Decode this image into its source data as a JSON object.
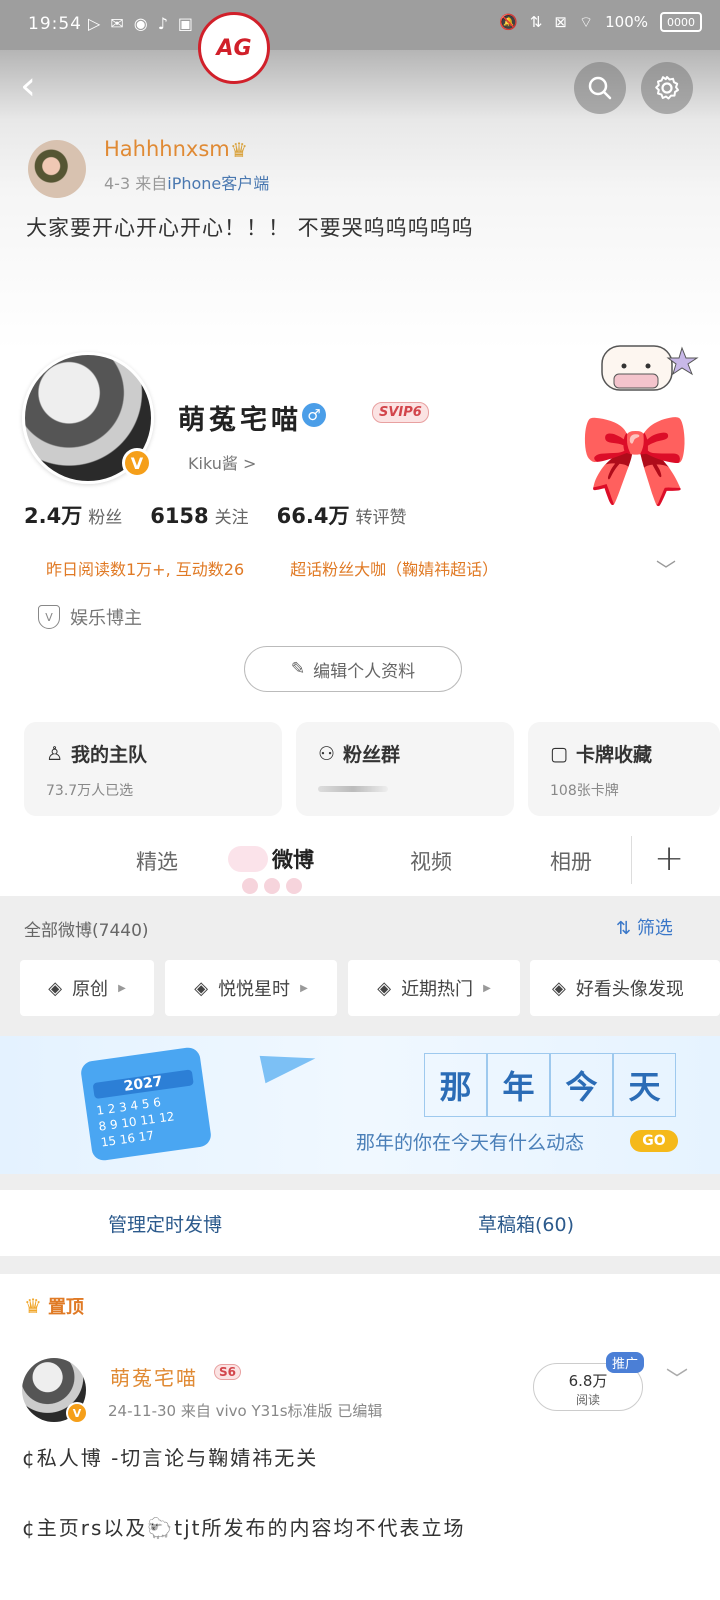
{
  "status_bar": {
    "time": "19:54",
    "battery": "100%",
    "battery_level": "0000"
  },
  "nav": {
    "back_icon": "chevron-left-icon",
    "search_icon": "search-icon",
    "settings_icon": "gear-icon"
  },
  "top_post": {
    "author": "Hahhhnxsm",
    "date": "4-3",
    "from_label": "来自",
    "source": "iPhone客户端",
    "text": "大家要开心开心开心！！！ 不要哭呜呜呜呜呜"
  },
  "profile": {
    "name": "萌菟宅喵",
    "svip": "SVIP6",
    "kiku": "Kiku酱 >",
    "vbadge": "V",
    "stats": [
      {
        "num": "2.4万",
        "label": "粉丝"
      },
      {
        "num": "6158",
        "label": "关注"
      },
      {
        "num": "66.4万",
        "label": "转评赞"
      }
    ],
    "hint_1": "昨日阅读数1万+, 互动数26",
    "hint_2": "超话粉丝大咖（鞠婧祎超话）",
    "role": "娱乐博主",
    "edit_button": "编辑个人资料"
  },
  "cards": [
    {
      "title": "我的主队",
      "sub": "73.7万人已选",
      "logo": "AG"
    },
    {
      "title": "粉丝群",
      "sub": ""
    },
    {
      "title": "卡牌收藏",
      "sub": "108张卡牌"
    }
  ],
  "tabs": {
    "items": [
      "精选",
      "微博",
      "视频",
      "相册"
    ],
    "active": "微博",
    "plus": "+"
  },
  "filter_bar": {
    "all_weibo": "全部微博(7440)",
    "filter": "筛选",
    "chips": [
      "原创",
      "悦悦星时",
      "近期热门",
      "好看头像发现"
    ]
  },
  "banner": {
    "calendar_year": "2027",
    "calendar_numbers": "1 2 3 4 5 6\n8 9 10 11 12\n15 16 17",
    "title_chars": [
      "那",
      "年",
      "今",
      "天"
    ],
    "sub": "那年的你在今天有什么动态",
    "go": "GO"
  },
  "actions": {
    "schedule": "管理定时发博",
    "drafts": "草稿箱(60)"
  },
  "pinned": {
    "label": "置顶"
  },
  "feed_post": {
    "name": "萌菟宅喵",
    "badge": "S6",
    "vbadge": "V",
    "meta": "24-11-30  来自 vivo Y31s标准版  已编辑",
    "reads_num": "6.8万",
    "reads_label": "阅读",
    "promo": "推广",
    "line_1": "¢私人博 -切言论与鞠婧祎无关",
    "line_2": "¢主页rs以及🐑tjt所发布的内容均不代表立场"
  },
  "colors": {
    "accent_orange": "#e08a34",
    "link_blue": "#3a77c8",
    "vip_red": "#d2454b"
  }
}
